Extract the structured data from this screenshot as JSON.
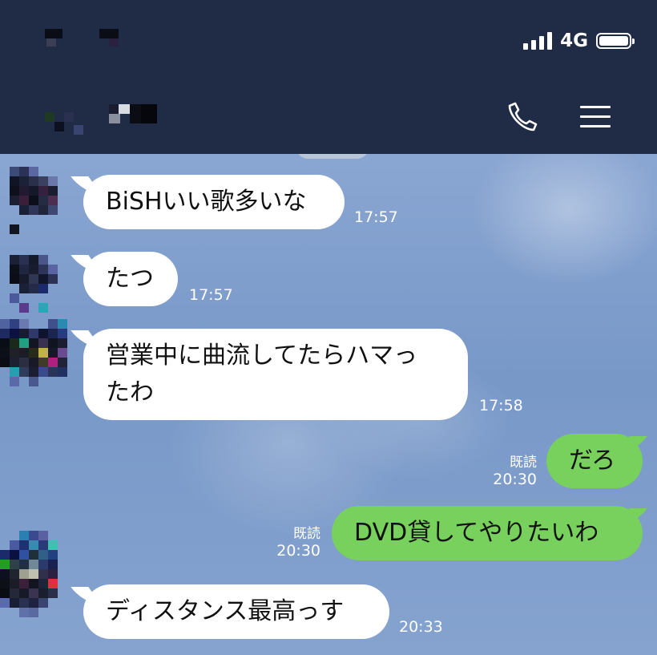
{
  "status_bar": {
    "network": "4G",
    "signal_bars": 4,
    "battery_level": 1.0
  },
  "header": {
    "call_icon": "phone-icon",
    "menu_icon": "hamburger-menu-icon"
  },
  "messages": [
    {
      "direction": "in",
      "text": "BiSHいい歌多いな",
      "time": "17:57"
    },
    {
      "direction": "in",
      "text": "たつ",
      "time": "17:57"
    },
    {
      "direction": "in",
      "text_lines": [
        "営業中に曲流してたらハマっ",
        "たわ"
      ],
      "time": "17:58"
    },
    {
      "direction": "out",
      "text": "だろ",
      "read": "既読",
      "time": "20:30"
    },
    {
      "direction": "out",
      "text": "DVD貸してやりたいわ",
      "read": "既読",
      "time": "20:30"
    },
    {
      "direction": "in",
      "text": "ディスタンス最高っす",
      "time": "20:33"
    }
  ],
  "colors": {
    "header_bg": "#202b45",
    "chat_bg": "#7e9cc9",
    "outgoing_bubble": "#77d15c",
    "incoming_bubble": "#ffffff"
  }
}
